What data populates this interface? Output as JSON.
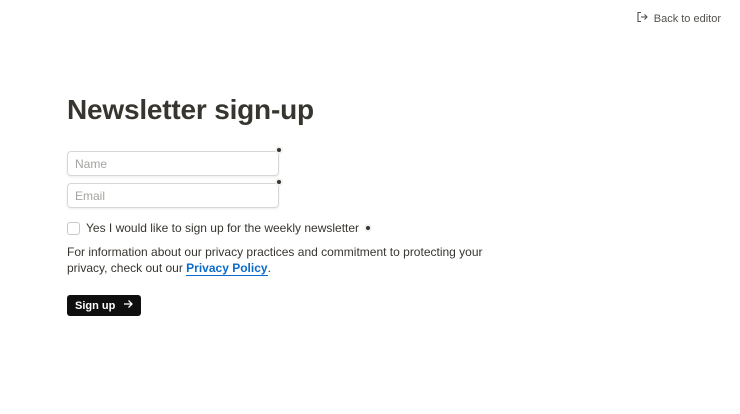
{
  "header": {
    "back_label": "Back to editor",
    "back_icon": "exit-icon"
  },
  "form": {
    "title": "Newsletter sign-up",
    "name_placeholder": "Name",
    "email_placeholder": "Email",
    "checkbox_label": "Yes I would like to sign up for the weekly newsletter",
    "privacy_text_before": "For information about our privacy practices and commitment to protecting your privacy, check out our ",
    "privacy_link": "Privacy Policy",
    "privacy_text_after": ".",
    "submit_label": "Sign up",
    "submit_icon": "arrow-right-icon"
  },
  "colors": {
    "accent_link": "#0b6bcb",
    "button_bg": "#0f0f0f",
    "text": "#37352f"
  }
}
